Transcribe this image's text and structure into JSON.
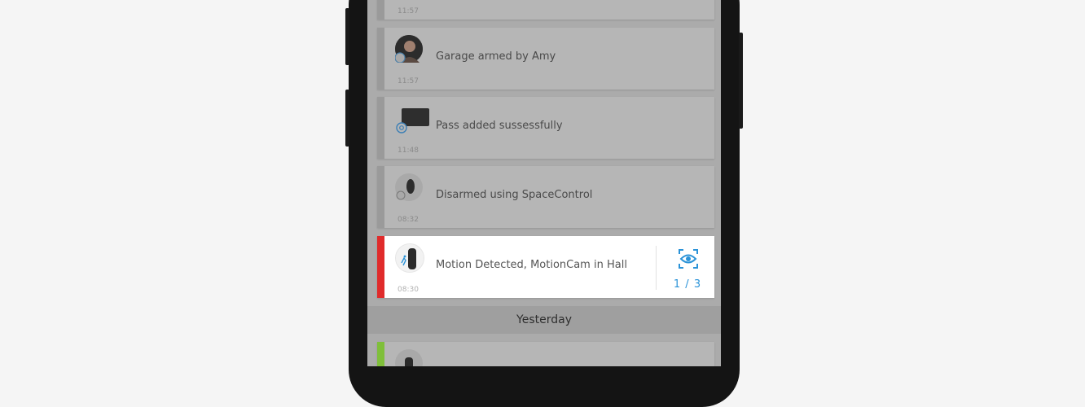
{
  "events": [
    {
      "time": "11:57",
      "message": ""
    },
    {
      "message": "Garage armed by Amy",
      "time": "11:57",
      "icon": "user-avatar-icon"
    },
    {
      "message": "Pass added sussessfully",
      "time": "11:48",
      "icon": "keypad-pass-icon"
    },
    {
      "message": "Disarmed using SpaceControl",
      "time": "08:32",
      "icon": "spacecontrol-keyfob-icon"
    },
    {
      "message": "Motion Detected, MotionCam in Hall",
      "time": "08:30",
      "icon": "motioncam-icon",
      "counter": "1 / 3"
    }
  ],
  "section_label": "Yesterday",
  "colors": {
    "alarm_stripe": "#e02b2b",
    "ok_stripe": "#7fbf3a",
    "accent": "#2b93d8"
  }
}
